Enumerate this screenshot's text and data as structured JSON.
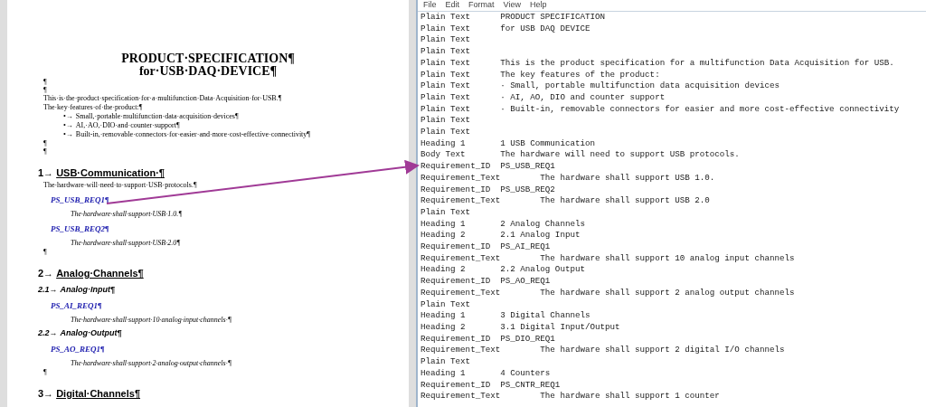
{
  "document": {
    "blocks": [
      {
        "kind": "title",
        "text": "PRODUCT·SPECIFICATION¶"
      },
      {
        "kind": "title",
        "text": "for·USB·DAQ·DEVICE¶"
      },
      {
        "kind": "empty",
        "text": "¶"
      },
      {
        "kind": "empty",
        "text": "¶"
      },
      {
        "kind": "body",
        "text": "This·is·the·product·specification·for·a·multifunction·Data·Acquisition·for·USB.¶"
      },
      {
        "kind": "body",
        "text": "The·key·features·of·the·product:¶"
      },
      {
        "kind": "bullet",
        "marker": "•→",
        "text": "Small,·portable·multifunction·data·acquisition·devices¶"
      },
      {
        "kind": "bullet",
        "marker": "•→",
        "text": "AI,·AO,·DIO·and·counter·support¶"
      },
      {
        "kind": "bullet",
        "marker": "•→",
        "text": "Built-in,·removable·connectors·for·easier·and·more·cost-effective·connectivity¶"
      },
      {
        "kind": "empty",
        "text": "¶"
      },
      {
        "kind": "empty",
        "text": "¶"
      },
      {
        "kind": "heading1",
        "number": "1→",
        "text": "USB·Communication·¶"
      },
      {
        "kind": "body",
        "text": "The·hardware·will·need·to·support·USB·protocols.¶"
      },
      {
        "kind": "req_id",
        "text": "PS_USB_REQ1¶"
      },
      {
        "kind": "req_text",
        "text": "The·hardware·shall·support·USB·1.0.¶"
      },
      {
        "kind": "req_id",
        "text": "PS_USB_REQ2¶"
      },
      {
        "kind": "req_text",
        "text": "The·hardware·shall·support·USB·2.0¶"
      },
      {
        "kind": "empty",
        "text": "¶"
      },
      {
        "kind": "heading1",
        "number": "2→",
        "text": "Analog·Channels¶"
      },
      {
        "kind": "heading2",
        "number": "2.1→",
        "text": "Analog·Input¶"
      },
      {
        "kind": "req_id",
        "text": "PS_AI_REQ1¶"
      },
      {
        "kind": "req_text",
        "text": "The·hardware·shall·support·10·analog·input·channels·¶"
      },
      {
        "kind": "heading2",
        "number": "2.2→",
        "text": "Analog·Output¶"
      },
      {
        "kind": "req_id",
        "text": "PS_AO_REQ1¶"
      },
      {
        "kind": "req_text",
        "text": "The·hardware·shall·support·2·analog·output·channels·¶"
      },
      {
        "kind": "empty",
        "text": "¶"
      },
      {
        "kind": "heading1",
        "number": "3→",
        "text": "Digital·Channels¶"
      }
    ]
  },
  "notepad": {
    "menu": [
      "File",
      "Edit",
      "Format",
      "View",
      "Help"
    ],
    "lines": [
      "Plain Text\tPRODUCT SPECIFICATION",
      "Plain Text\tfor USB DAQ DEVICE",
      "Plain Text",
      "Plain Text",
      "Plain Text\tThis is the product specification for a multifunction Data Acquisition for USB.",
      "Plain Text\tThe key features of the product:",
      "Plain Text\t· Small, portable multifunction data acquisition devices",
      "Plain Text\t· AI, AO, DIO and counter support",
      "Plain Text\t· Built-in, removable connectors for easier and more cost-effective connectivity",
      "Plain Text",
      "Plain Text",
      "Heading 1\t1 USB Communication",
      "Body Text\tThe hardware will need to support USB protocols.",
      "Requirement_ID  PS_USB_REQ1",
      "Requirement_Text\tThe hardware shall support USB 1.0.",
      "Requirement_ID  PS_USB_REQ2",
      "Requirement_Text\tThe hardware shall support USB 2.0",
      "Plain Text",
      "Heading 1\t2 Analog Channels",
      "Heading 2\t2.1 Analog Input",
      "Requirement_ID  PS_AI_REQ1",
      "Requirement_Text\tThe hardware shall support 10 analog input channels",
      "Heading 2\t2.2 Analog Output",
      "Requirement_ID  PS_AO_REQ1",
      "Requirement_Text\tThe hardware shall support 2 analog output channels",
      "Plain Text",
      "Heading 1\t3 Digital Channels",
      "Heading 2\t3.1 Digital Input/Output",
      "Requirement_ID  PS_DIO_REQ1",
      "Requirement_Text\tThe hardware shall support 2 digital I/O channels",
      "Plain Text",
      "Heading 1\t4 Counters",
      "Requirement_ID  PS_CNTR_REQ1",
      "Requirement_Text\tThe hardware shall support 1 counter"
    ]
  }
}
